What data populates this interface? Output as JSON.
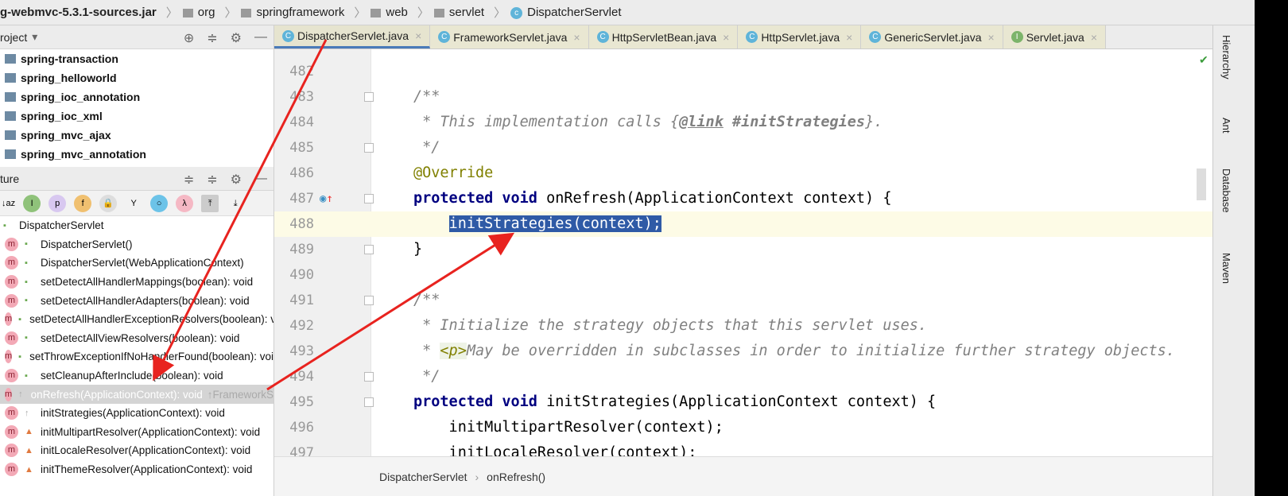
{
  "nav_bar": {
    "items": [
      "g-webmvc-5.3.1-sources.jar",
      "org",
      "springframework",
      "web",
      "servlet",
      "DispatcherServlet"
    ]
  },
  "project_panel": {
    "title": "roject",
    "items": [
      "spring-transaction",
      "spring_helloworld",
      "spring_ioc_annotation",
      "spring_ioc_xml",
      "spring_mvc_ajax",
      "spring_mvc_annotation"
    ]
  },
  "structure_panel": {
    "title": "ture",
    "root": "DispatcherServlet",
    "items": [
      {
        "label": "DispatcherServlet()",
        "vis": "public"
      },
      {
        "label": "DispatcherServlet(WebApplicationContext)",
        "vis": "public"
      },
      {
        "label": "setDetectAllHandlerMappings(boolean): void",
        "vis": "public"
      },
      {
        "label": "setDetectAllHandlerAdapters(boolean): void",
        "vis": "public"
      },
      {
        "label": "setDetectAllHandlerExceptionResolvers(boolean): void",
        "vis": "public"
      },
      {
        "label": "setDetectAllViewResolvers(boolean): void",
        "vis": "public"
      },
      {
        "label": "setThrowExceptionIfNoHandlerFound(boolean): void",
        "vis": "public"
      },
      {
        "label": "setCleanupAfterInclude(boolean): void",
        "vis": "public"
      },
      {
        "label": "onRefresh(ApplicationContext): void",
        "suffix": "↑FrameworkServlet",
        "vis": "protected",
        "selected": true
      },
      {
        "label": "initStrategies(ApplicationContext): void",
        "vis": "protected"
      },
      {
        "label": "initMultipartResolver(ApplicationContext): void",
        "vis": "private"
      },
      {
        "label": "initLocaleResolver(ApplicationContext): void",
        "vis": "private"
      },
      {
        "label": "initThemeResolver(ApplicationContext): void",
        "vis": "private"
      }
    ]
  },
  "tabs": [
    {
      "label": "DispatcherServlet.java",
      "icon": "c",
      "active": true
    },
    {
      "label": "FrameworkServlet.java",
      "icon": "c"
    },
    {
      "label": "HttpServletBean.java",
      "icon": "c"
    },
    {
      "label": "HttpServlet.java",
      "icon": "c"
    },
    {
      "label": "GenericServlet.java",
      "icon": "c"
    },
    {
      "label": "Servlet.java",
      "icon": "i"
    }
  ],
  "editor": {
    "lines": [
      {
        "n": "482",
        "html": ""
      },
      {
        "n": "483",
        "html": "<span class='cm'>/**</span>"
      },
      {
        "n": "484",
        "html": "<span class='cm'> * This implementation calls {<b><u>@link</u></b> <b>#initStrategies</b>}.</span>"
      },
      {
        "n": "485",
        "html": "<span class='cm'> */</span>"
      },
      {
        "n": "486",
        "html": "<span class='an'>@Override</span>"
      },
      {
        "n": "487",
        "html": "<span class='kw'>protected void</span> onRefresh(ApplicationContext context) {"
      },
      {
        "n": "488",
        "html": "    <span class='sel'>initStrategies(context);</span>",
        "current": true
      },
      {
        "n": "489",
        "html": "}"
      },
      {
        "n": "490",
        "html": ""
      },
      {
        "n": "491",
        "html": "<span class='cm'>/**</span>"
      },
      {
        "n": "492",
        "html": "<span class='cm'> * Initialize the strategy objects that this servlet uses.</span>"
      },
      {
        "n": "493",
        "html": "<span class='cm'> * <span class='tag'>&lt;p&gt;</span>May be overridden in subclasses in order to initialize further strategy objects.</span>"
      },
      {
        "n": "494",
        "html": "<span class='cm'> */</span>"
      },
      {
        "n": "495",
        "html": "<span class='kw'>protected void</span> initStrategies(ApplicationContext context) {"
      },
      {
        "n": "496",
        "html": "    initMultipartResolver(context);"
      },
      {
        "n": "497",
        "html": "    initLocaleResolver(context);"
      }
    ]
  },
  "breadcrumb": {
    "items": [
      "DispatcherServlet",
      "onRefresh()"
    ]
  },
  "right_tools": [
    "Hierarchy",
    "Ant",
    "Database",
    "Maven"
  ],
  "colors": {
    "selection": "#2f5aa6",
    "annotation_arrow": "#e8231f",
    "keyword": "#000080"
  }
}
